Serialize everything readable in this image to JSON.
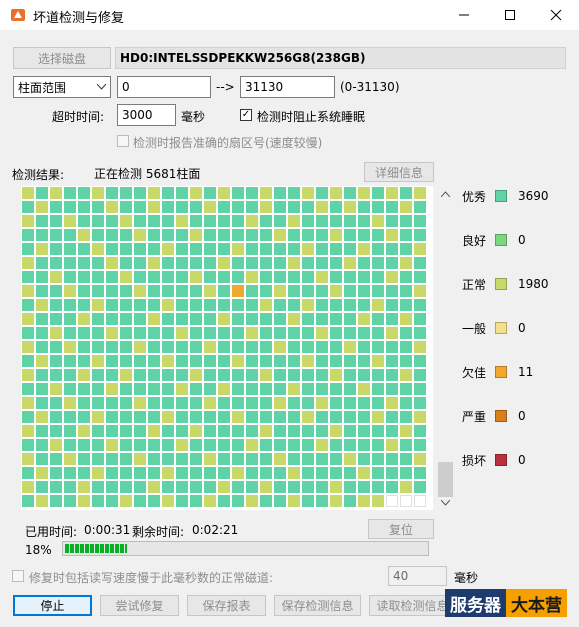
{
  "window": {
    "title": "坏道检测与修复"
  },
  "controls": {
    "select_disk": "选择磁盘",
    "disk_name": "HD0:INTELSSDPEKKW256G8(238GB)",
    "range_mode": "柱面范围",
    "range_start": "0",
    "arrow": "-->",
    "range_end": "31130",
    "range_hint": "(0-31130)",
    "timeout_label": "超时时间:",
    "timeout_value": "3000",
    "timeout_unit": "毫秒",
    "prevent_sleep_label": "检测时阻止系统睡眠",
    "prevent_sleep_checked": true,
    "report_sector_label": "检测时报告准确的扇区号(速度较慢)",
    "report_sector_checked": false
  },
  "results": {
    "label": "检测结果:",
    "status": "正在检测 5681柱面",
    "details_button": "详细信息"
  },
  "grid": {
    "columns": 29,
    "rows": 23,
    "last_row_filled": 26,
    "orange_cell": {
      "row": 7,
      "col": 15
    },
    "colors": {
      "excellent": "#5fd3a5",
      "normal": "#c8d96a",
      "empty": "#ffffff"
    },
    "yellow_positions": [
      [
        0,
        0
      ],
      [
        0,
        2
      ],
      [
        0,
        5
      ],
      [
        0,
        9
      ],
      [
        0,
        12
      ],
      [
        0,
        14
      ],
      [
        0,
        17
      ],
      [
        0,
        20
      ],
      [
        0,
        22
      ],
      [
        0,
        24
      ],
      [
        0,
        26
      ],
      [
        0,
        28
      ],
      [
        1,
        1
      ],
      [
        1,
        6
      ],
      [
        1,
        9
      ],
      [
        1,
        13
      ],
      [
        1,
        17
      ],
      [
        1,
        21
      ],
      [
        1,
        23
      ],
      [
        1,
        27
      ],
      [
        2,
        0
      ],
      [
        2,
        3
      ],
      [
        2,
        7
      ],
      [
        2,
        11
      ],
      [
        2,
        16
      ],
      [
        2,
        19
      ],
      [
        2,
        25
      ],
      [
        3,
        4
      ],
      [
        3,
        8
      ],
      [
        3,
        12
      ],
      [
        3,
        18
      ],
      [
        3,
        22
      ],
      [
        3,
        26
      ],
      [
        4,
        1
      ],
      [
        4,
        5
      ],
      [
        4,
        10
      ],
      [
        4,
        15
      ],
      [
        4,
        20
      ],
      [
        4,
        24
      ],
      [
        4,
        28
      ],
      [
        5,
        0
      ],
      [
        5,
        6
      ],
      [
        5,
        9
      ],
      [
        5,
        14
      ],
      [
        5,
        19
      ],
      [
        5,
        23
      ],
      [
        5,
        27
      ],
      [
        6,
        2
      ],
      [
        6,
        7
      ],
      [
        6,
        12
      ],
      [
        6,
        16
      ],
      [
        6,
        21
      ],
      [
        6,
        26
      ],
      [
        7,
        0
      ],
      [
        7,
        3
      ],
      [
        7,
        8
      ],
      [
        7,
        13
      ],
      [
        7,
        18
      ],
      [
        7,
        22
      ],
      [
        7,
        28
      ],
      [
        8,
        1
      ],
      [
        8,
        5
      ],
      [
        8,
        10
      ],
      [
        8,
        17
      ],
      [
        8,
        20
      ],
      [
        8,
        25
      ],
      [
        9,
        0
      ],
      [
        9,
        4
      ],
      [
        9,
        9
      ],
      [
        9,
        14
      ],
      [
        9,
        19
      ],
      [
        9,
        24
      ],
      [
        9,
        27
      ],
      [
        10,
        2
      ],
      [
        10,
        6
      ],
      [
        10,
        11
      ],
      [
        10,
        16
      ],
      [
        10,
        21
      ],
      [
        10,
        26
      ],
      [
        11,
        0
      ],
      [
        11,
        3
      ],
      [
        11,
        8
      ],
      [
        11,
        13
      ],
      [
        11,
        18
      ],
      [
        11,
        23
      ],
      [
        11,
        28
      ],
      [
        12,
        1
      ],
      [
        12,
        5
      ],
      [
        12,
        10
      ],
      [
        12,
        15
      ],
      [
        12,
        20
      ],
      [
        12,
        25
      ],
      [
        13,
        0
      ],
      [
        13,
        4
      ],
      [
        13,
        7
      ],
      [
        13,
        12
      ],
      [
        13,
        17
      ],
      [
        13,
        22
      ],
      [
        13,
        27
      ],
      [
        14,
        2
      ],
      [
        14,
        6
      ],
      [
        14,
        11
      ],
      [
        14,
        14
      ],
      [
        14,
        19
      ],
      [
        14,
        24
      ],
      [
        15,
        0
      ],
      [
        15,
        3
      ],
      [
        15,
        8
      ],
      [
        15,
        13
      ],
      [
        15,
        18
      ],
      [
        15,
        21
      ],
      [
        15,
        26
      ],
      [
        16,
        1
      ],
      [
        16,
        5
      ],
      [
        16,
        10
      ],
      [
        16,
        15
      ],
      [
        16,
        20
      ],
      [
        16,
        25
      ],
      [
        16,
        28
      ],
      [
        17,
        0
      ],
      [
        17,
        4
      ],
      [
        17,
        9
      ],
      [
        17,
        12
      ],
      [
        17,
        17
      ],
      [
        17,
        22
      ],
      [
        17,
        27
      ],
      [
        18,
        2
      ],
      [
        18,
        6
      ],
      [
        18,
        11
      ],
      [
        18,
        16
      ],
      [
        18,
        21
      ],
      [
        18,
        26
      ],
      [
        19,
        0
      ],
      [
        19,
        3
      ],
      [
        19,
        8
      ],
      [
        19,
        13
      ],
      [
        19,
        18
      ],
      [
        19,
        23
      ],
      [
        19,
        28
      ],
      [
        20,
        1
      ],
      [
        20,
        5
      ],
      [
        20,
        10
      ],
      [
        20,
        15
      ],
      [
        20,
        19
      ],
      [
        20,
        24
      ],
      [
        21,
        0
      ],
      [
        21,
        4
      ],
      [
        21,
        9
      ],
      [
        21,
        14
      ],
      [
        21,
        17
      ],
      [
        21,
        22
      ],
      [
        21,
        27
      ],
      [
        22,
        1
      ],
      [
        22,
        4
      ],
      [
        22,
        7
      ],
      [
        22,
        10
      ],
      [
        22,
        13
      ],
      [
        22,
        16
      ],
      [
        22,
        19
      ],
      [
        22,
        22
      ],
      [
        22,
        24
      ],
      [
        22,
        25
      ]
    ]
  },
  "legend": [
    {
      "label": "优秀",
      "color": "#5fd3a5",
      "value": "3690"
    },
    {
      "label": "良好",
      "color": "#7ed67e",
      "value": "0"
    },
    {
      "label": "正常",
      "color": "#c8d96a",
      "value": "1980"
    },
    {
      "label": "一般",
      "color": "#f2e08a",
      "value": "0"
    },
    {
      "label": "欠佳",
      "color": "#f0a830",
      "value": "11"
    },
    {
      "label": "严重",
      "color": "#d9801e",
      "value": "0"
    },
    {
      "label": "损坏",
      "color": "#b7303a",
      "value": "0"
    }
  ],
  "timing": {
    "elapsed_label": "已用时间:",
    "elapsed": "0:00:31",
    "remaining_label": "剩余时间:",
    "remaining": "0:02:21",
    "reset_button": "复位"
  },
  "progress": {
    "percent_text": "18%",
    "fraction": 0.18
  },
  "repair_option": {
    "label": "修复时包括读写速度慢于此毫秒数的正常磁道:",
    "value": "40",
    "unit": "毫秒"
  },
  "buttons": {
    "stop": "停止",
    "try_repair": "尝试修复",
    "save_report": "保存报表",
    "save_info": "保存检测信息",
    "load_info": "读取检测信息"
  },
  "watermark": {
    "part1": "服务器",
    "part2": "大本营"
  }
}
